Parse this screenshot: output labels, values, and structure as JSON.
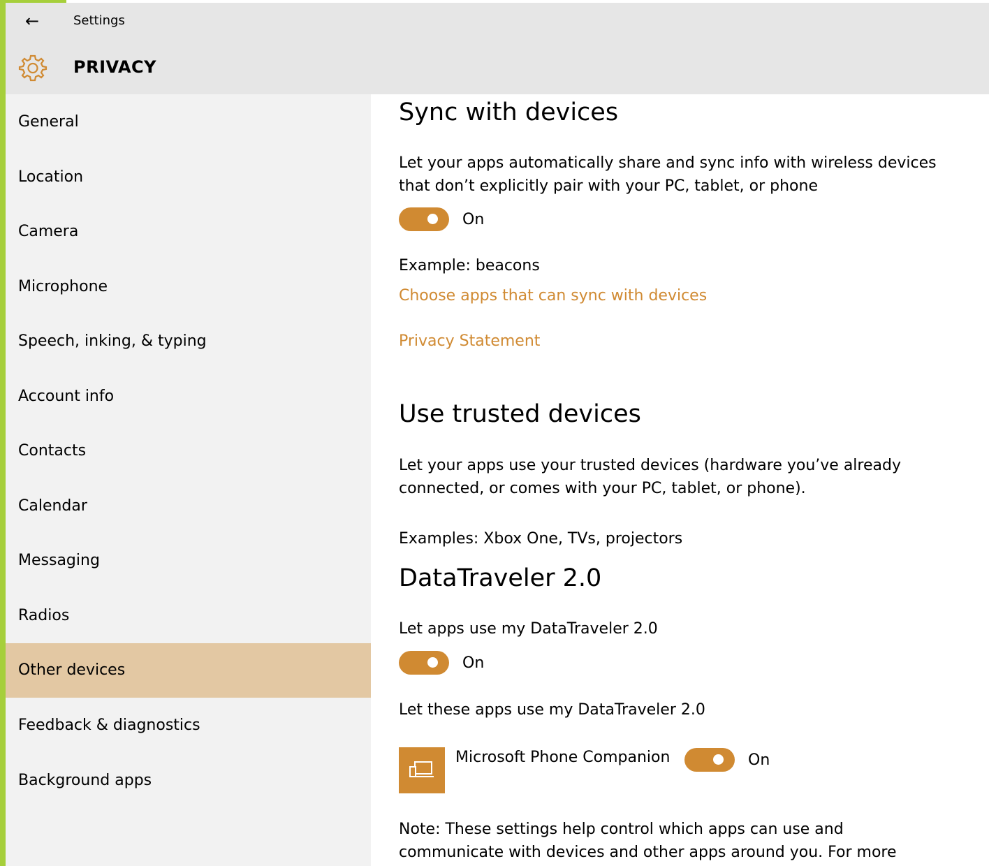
{
  "header": {
    "window_title": "Settings",
    "page_title": "PRIVACY",
    "back_icon": "back-arrow-icon",
    "settings_icon": "gear-icon"
  },
  "sidebar": {
    "items": [
      {
        "label": "General"
      },
      {
        "label": "Location"
      },
      {
        "label": "Camera"
      },
      {
        "label": "Microphone"
      },
      {
        "label": "Speech, inking, & typing"
      },
      {
        "label": "Account info"
      },
      {
        "label": "Contacts"
      },
      {
        "label": "Calendar"
      },
      {
        "label": "Messaging"
      },
      {
        "label": "Radios"
      },
      {
        "label": "Other devices"
      },
      {
        "label": "Feedback & diagnostics"
      },
      {
        "label": "Background apps"
      }
    ],
    "selected": "Other devices"
  },
  "sync": {
    "heading": "Sync with devices",
    "description": "Let your apps automatically share and sync info with wireless devices that don’t explicitly pair with your PC, tablet, or phone",
    "toggle_state": "On",
    "example": "Example: beacons",
    "choose_link": "Choose apps that can sync with devices",
    "privacy_link": "Privacy Statement"
  },
  "trusted": {
    "heading": "Use trusted devices",
    "description": "Let your apps use your trusted devices (hardware you’ve already connected, or comes with your PC, tablet, or phone).",
    "examples": "Examples: Xbox One, TVs, projectors"
  },
  "datatraveler": {
    "heading": "DataTraveler 2.0",
    "allow_label": "Let apps use my DataTraveler 2.0",
    "toggle_state": "On",
    "apps_label": "Let these apps use my DataTraveler 2.0",
    "apps": [
      {
        "name": "Microsoft Phone Companion",
        "icon": "phone-companion-icon",
        "toggle_state": "On"
      }
    ]
  },
  "note": {
    "text": "Note: These settings help control which apps can use and communicate with devices and other apps around you. For more"
  },
  "colors": {
    "accent": "#d08a32",
    "selected_bg": "#e3c8a3",
    "sidebar_bg": "#f2f2f2",
    "header_bg": "#e6e6e6",
    "edge_green": "#a6cf3b"
  }
}
